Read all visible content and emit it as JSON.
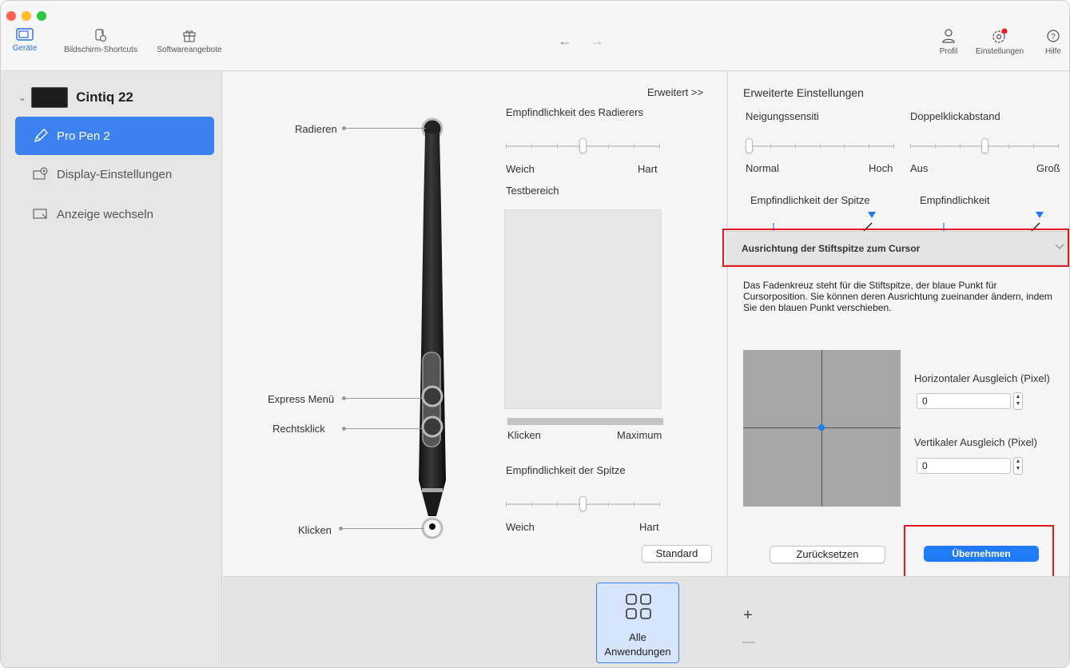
{
  "toolbar": {
    "tabs": [
      {
        "label": "Geräte",
        "icon": "tablet-icon",
        "active": true
      },
      {
        "label": "Bildschirm-Shortcuts",
        "icon": "shortcut-icon",
        "active": false
      },
      {
        "label": "Softwareangebote",
        "icon": "gift-icon",
        "active": false
      }
    ],
    "right": [
      {
        "label": "Profil",
        "icon": "profile-icon"
      },
      {
        "label": "Einstellungen",
        "icon": "settings-gear-icon"
      },
      {
        "label": "Hilfe",
        "icon": "help-icon"
      }
    ],
    "back_glyph": "←",
    "forward_glyph": "→"
  },
  "sidebar": {
    "device": "Cintiq 22",
    "expand_glyph": "⌄",
    "items": [
      {
        "label": "Pro Pen 2",
        "icon": "pen-icon",
        "active": true
      },
      {
        "label": "Display-Einstellungen",
        "icon": "display-settings-icon",
        "active": false
      },
      {
        "label": "Anzeige wechseln",
        "icon": "switch-display-icon",
        "active": false
      }
    ]
  },
  "pen": {
    "labels": {
      "eraser": "Radieren",
      "express_menu": "Express Menü",
      "right_click": "Rechtsklick",
      "click": "Klicken"
    }
  },
  "center": {
    "advanced_link": "Erweitert >>",
    "eraser_sensitivity": {
      "title": "Empfindlichkeit des Radierers",
      "min": "Weich",
      "max": "Hart",
      "level": 0.5
    },
    "test_area": {
      "title": "Testbereich",
      "min": "Klicken",
      "max": "Maximum"
    },
    "tip_sensitivity": {
      "title": "Empfindlichkeit der Spitze",
      "min": "Weich",
      "max": "Hart",
      "level": 0.5
    },
    "default_button": "Standard"
  },
  "right": {
    "title": "Erweiterte Einstellungen",
    "tilt": {
      "title": "Neigungssensiti",
      "min": "Normal",
      "max": "Hoch",
      "level": 0.0
    },
    "double_click": {
      "title": "Doppelklickabstand",
      "min": "Aus",
      "max": "Groß",
      "level": 0.5
    },
    "tip_sensitivity_label": "Empfindlichkeit der Spitze",
    "sensitivity_label": "Empfindlichkeit",
    "accordion_title": "Ausrichtung der Stiftspitze zum Cursor",
    "description": "Das Fadenkreuz steht für die Stiftspitze, der blaue Punkt für Cursorposition. Sie können deren Ausrichtung zueinander ändern, indem Sie den blauen Punkt verschieben.",
    "horizontal_label": "Horizontaler Ausgleich (Pixel)",
    "horizontal_value": "0",
    "vertical_label": "Vertikaler Ausgleich (Pixel)",
    "vertical_value": "0",
    "reset_button": "Zurücksetzen",
    "apply_button": "Übernehmen"
  },
  "bottom": {
    "app_label_line1": "Alle",
    "app_label_line2": "Anwendungen",
    "add_glyph": "+",
    "remove_glyph": "—"
  },
  "colors": {
    "accent": "#1f7cf6",
    "sidebar_active": "#3b82f0",
    "highlight_red": "#e0191e",
    "cursor_dot": "#1f7cf6"
  }
}
